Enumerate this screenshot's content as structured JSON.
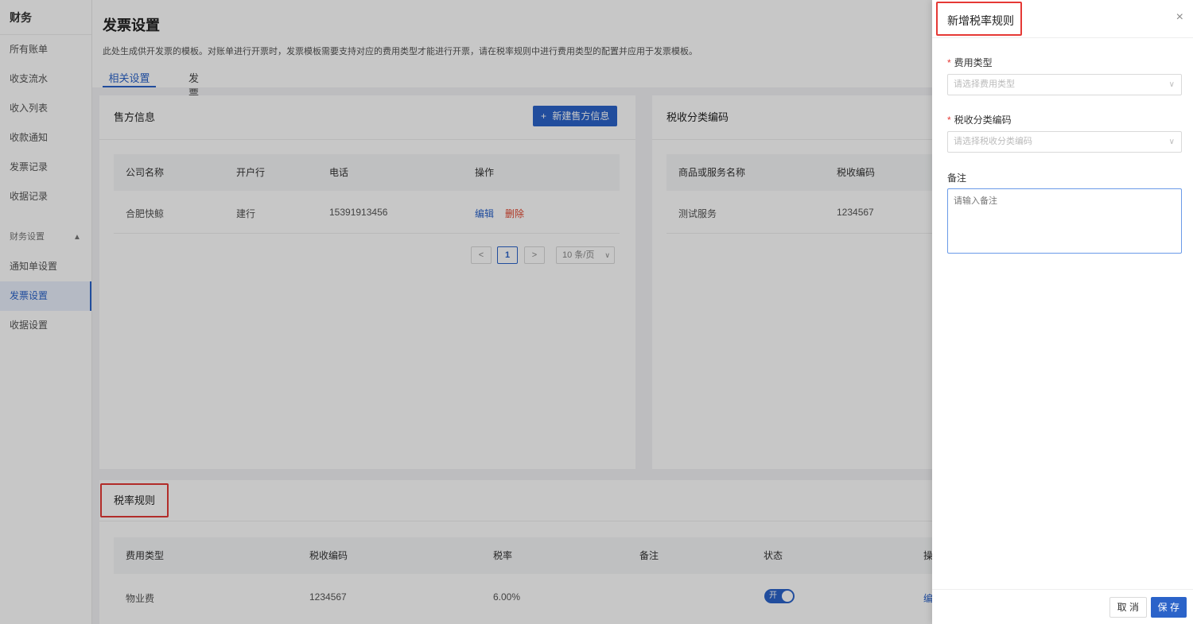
{
  "sidebar": {
    "title": "财务",
    "items": [
      "所有账单",
      "收支流水",
      "收入列表",
      "收款通知",
      "发票记录",
      "收据记录"
    ],
    "group": {
      "label": "财务设置",
      "items": [
        "通知单设置",
        "发票设置",
        "收据设置"
      ]
    }
  },
  "page": {
    "title": "发票设置",
    "desc": "此处生成供开发票的模板。对账单进行开票时，发票模板需要支持对应的费用类型才能进行开票，请在税率规则中进行费用类型的配置并应用于发票模板。",
    "tabs": [
      "相关设置",
      "发票模板"
    ]
  },
  "seller": {
    "title": "售方信息",
    "add_button": "新建售方信息",
    "columns": [
      "公司名称",
      "开户行",
      "电话",
      "操作"
    ],
    "row": {
      "company": "合肥快鲸",
      "bank": "建行",
      "phone": "15391913456",
      "edit": "编辑",
      "delete": "删除"
    },
    "pager": {
      "prev": "<",
      "page": "1",
      "next": ">",
      "size": "10 条/页"
    }
  },
  "tax_code": {
    "title": "税收分类编码",
    "columns": [
      "商品或服务名称",
      "税收编码"
    ],
    "row": {
      "name": "测试服务",
      "code": "1234567"
    }
  },
  "tax_rule": {
    "title": "税率规则",
    "columns": [
      "费用类型",
      "税收编码",
      "税率",
      "备注",
      "状态",
      "操"
    ],
    "row": {
      "type": "物业费",
      "code": "1234567",
      "rate": "6.00%",
      "note": "",
      "switch": "开",
      "op": "编"
    }
  },
  "drawer": {
    "title": "新增税率规则",
    "close": "×",
    "fee_type_label": "费用类型",
    "fee_type_placeholder": "请选择费用类型",
    "tax_code_label": "税收分类编码",
    "tax_code_placeholder": "请选择税收分类编码",
    "note_label": "备注",
    "note_placeholder": "请输入备注",
    "cancel": "取 消",
    "save": "保 存"
  },
  "colors": {
    "primary": "#2b63c9",
    "danger": "#e0452e",
    "highlight": "#e53935"
  }
}
